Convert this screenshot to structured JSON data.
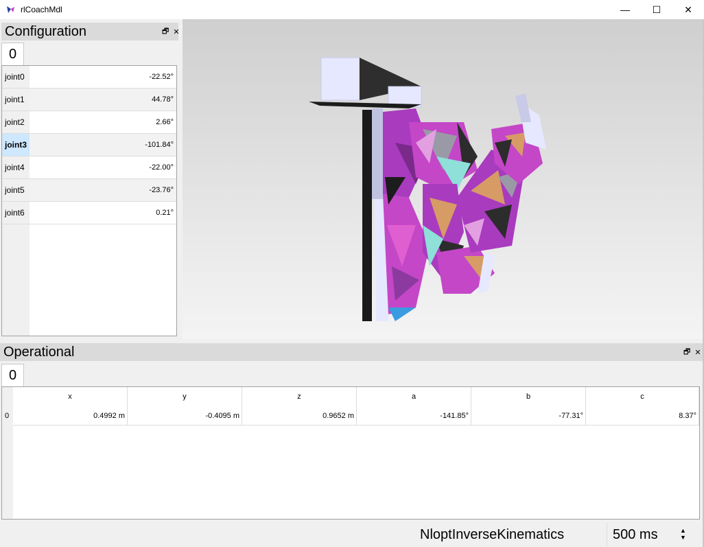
{
  "window": {
    "title": "rlCoachMdl",
    "minimize": "—",
    "maximize": "☐",
    "close": "✕"
  },
  "configuration": {
    "title": "Configuration",
    "float_icon": "🗗",
    "close_icon": "✕",
    "tab": "0",
    "joints": [
      {
        "name": "joint0",
        "value": "-22.52°"
      },
      {
        "name": "joint1",
        "value": "44.78°"
      },
      {
        "name": "joint2",
        "value": "2.66°"
      },
      {
        "name": "joint3",
        "value": "-101.84°"
      },
      {
        "name": "joint4",
        "value": "-22.00°"
      },
      {
        "name": "joint5",
        "value": "-23.76°"
      },
      {
        "name": "joint6",
        "value": "0.21°"
      }
    ]
  },
  "operational": {
    "title": "Operational",
    "float_icon": "🗗",
    "close_icon": "✕",
    "tab": "0",
    "columns": [
      "x",
      "y",
      "z",
      "a",
      "b",
      "c"
    ],
    "rows": [
      {
        "index": "0",
        "values": [
          "0.4992 m",
          "-0.4095 m",
          "0.9652 m",
          "-141.85°",
          "-77.31°",
          "8.37°"
        ]
      }
    ]
  },
  "status": {
    "solver": "NloptInverseKinematics",
    "interval": "500 ms",
    "spin_up": "▲",
    "spin_down": "▼"
  },
  "colors": {
    "robot_magenta": "#a93bbf",
    "robot_gray": "#9a9aa6",
    "robot_white": "#e6e8ff"
  }
}
